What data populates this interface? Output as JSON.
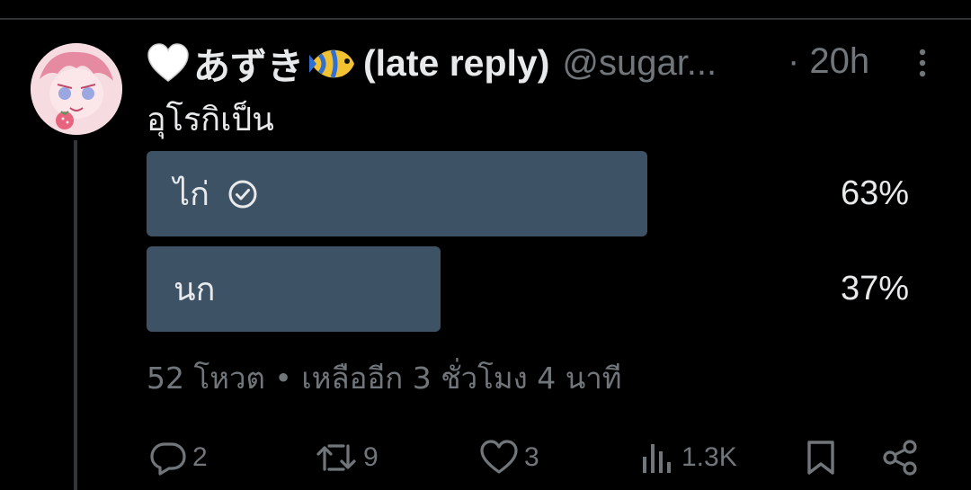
{
  "tweet": {
    "display_name": "あずき",
    "display_name_suffix": "(late reply)",
    "handle": "@sugar...",
    "time": "· 20h",
    "text": "อุโรกิเป็น"
  },
  "poll": {
    "options": [
      {
        "label": "ไก่",
        "percent": "63%",
        "fill_fraction": 0.63,
        "selected": true
      },
      {
        "label": "นก",
        "percent": "37%",
        "fill_fraction": 0.37,
        "selected": false
      }
    ],
    "meta": "52 โหวต • เหลืออีก 3 ชั่วโมง 4 นาที"
  },
  "actions": {
    "reply_count": "2",
    "retweet_count": "9",
    "like_count": "3",
    "views_count": "1.3K"
  },
  "icons": {
    "more": "more-vertical-icon",
    "reply": "reply-icon",
    "retweet": "retweet-icon",
    "like": "heart-icon",
    "views": "views-icon",
    "bookmark": "bookmark-icon",
    "share": "share-icon",
    "check": "check-circle-icon"
  },
  "colors": {
    "background": "#000000",
    "text": "#e7e9ea",
    "secondary": "#71767b",
    "poll_fill": "#3e5266",
    "divider": "#2f3336"
  }
}
